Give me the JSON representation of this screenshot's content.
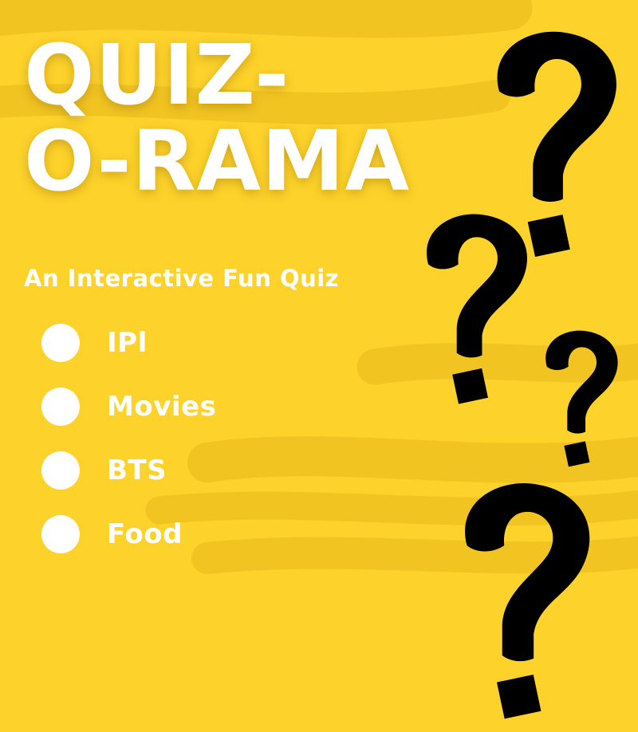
{
  "poster": {
    "title_line1": "QUIZ-",
    "title_line2": "O-RAMA",
    "subtitle": "An Interactive Fun Quiz",
    "options": [
      {
        "label": "IPl"
      },
      {
        "label": "Movies"
      },
      {
        "label": "BTS"
      },
      {
        "label": "Food"
      }
    ]
  },
  "colors": {
    "background": "#fdd22a",
    "text": "#ffffff",
    "outline": "#1a1a1a"
  },
  "icons": [
    "question-mark-icon"
  ]
}
